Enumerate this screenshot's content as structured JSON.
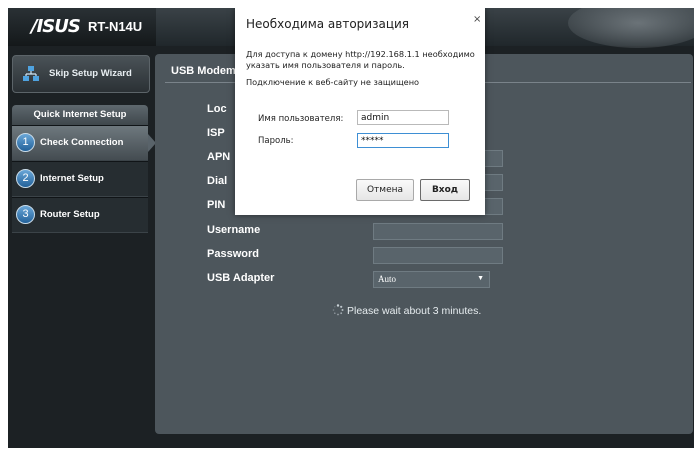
{
  "header": {
    "logo": "/ISUS",
    "model": "RT-N14U"
  },
  "sidebar": {
    "skip_label": "Skip Setup Wizard",
    "section_title": "Quick Internet Setup",
    "items": [
      {
        "num": "1",
        "label": "Check Connection",
        "active": true
      },
      {
        "num": "2",
        "label": "Internet Setup",
        "active": false
      },
      {
        "num": "3",
        "label": "Router Setup",
        "active": false
      }
    ]
  },
  "panel": {
    "title": "USB Modem",
    "rows": [
      "Location",
      "ISP",
      "APN",
      "Dial",
      "PIN",
      "Username",
      "Password",
      "USB Adapter"
    ],
    "visible_rows": [
      "Loc",
      "ISP",
      "APN",
      "Dial",
      "PIN",
      "Username",
      "Password",
      "USB Adapter"
    ],
    "usb_adapter_value": "Auto",
    "wait_text": "Please wait about 3 minutes."
  },
  "dialog": {
    "title": "Необходима авторизация",
    "close": "×",
    "message": "Для доступа к домену http://192.168.1.1 необходимо указать имя пользователя и пароль.",
    "warning": "Подключение к веб-сайту не защищено",
    "username_label": "Имя пользователя:",
    "username_value": "admin",
    "password_label": "Пароль:",
    "password_value": "*****",
    "cancel_label": "Отмена",
    "login_label": "Вход"
  },
  "colors": {
    "accent": "#3e8fd4",
    "panel": "#4d565c",
    "background": "#1c2124"
  }
}
